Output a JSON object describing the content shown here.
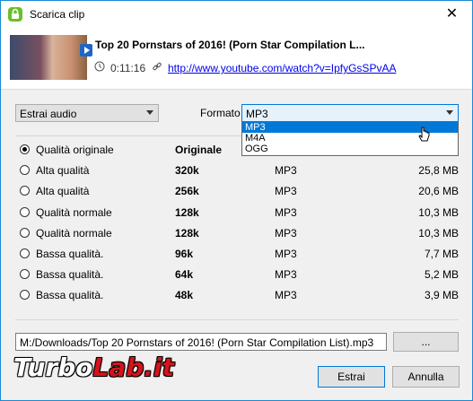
{
  "window": {
    "title": "Scarica clip",
    "close_glyph": "✕"
  },
  "clip": {
    "title": "Top 20 Pornstars of 2016! (Porn Star Compilation L...",
    "duration": "0:11:16",
    "url": "http://www.youtube.com/watch?v=IpfyGsSPvAA"
  },
  "action_select": {
    "value": "Estrai audio"
  },
  "format": {
    "label": "Formato",
    "value": "MP3",
    "options": [
      "MP3",
      "M4A",
      "OGG"
    ],
    "selected_index": 0
  },
  "qualities": [
    {
      "label": "Qualità originale",
      "bitrate": "Originale",
      "format": "",
      "size": "",
      "checked": true
    },
    {
      "label": "Alta qualità",
      "bitrate": "320k",
      "format": "MP3",
      "size": "25,8 MB",
      "checked": false
    },
    {
      "label": "Alta qualità",
      "bitrate": "256k",
      "format": "MP3",
      "size": "20,6 MB",
      "checked": false
    },
    {
      "label": "Qualità normale",
      "bitrate": "128k",
      "format": "MP3",
      "size": "10,3 MB",
      "checked": false
    },
    {
      "label": "Qualità normale",
      "bitrate": "128k",
      "format": "MP3",
      "size": "10,3 MB",
      "checked": false
    },
    {
      "label": "Bassa qualità.",
      "bitrate": "96k",
      "format": "MP3",
      "size": "7,7 MB",
      "checked": false
    },
    {
      "label": "Bassa qualità.",
      "bitrate": "64k",
      "format": "MP3",
      "size": "5,2 MB",
      "checked": false
    },
    {
      "label": "Bassa qualità.",
      "bitrate": "48k",
      "format": "MP3",
      "size": "3,9 MB",
      "checked": false
    }
  ],
  "output": {
    "path": "M:/Downloads/Top 20 Pornstars of 2016! (Porn Star Compilation List).mp3",
    "browse_label": "..."
  },
  "buttons": {
    "extract": "Estrai",
    "cancel": "Annulla"
  },
  "watermark": {
    "part1": "Turbo",
    "part2": "Lab.it"
  },
  "colors": {
    "accent": "#0078d7",
    "link": "#0000ee",
    "app_icon": "#6abf2a"
  }
}
